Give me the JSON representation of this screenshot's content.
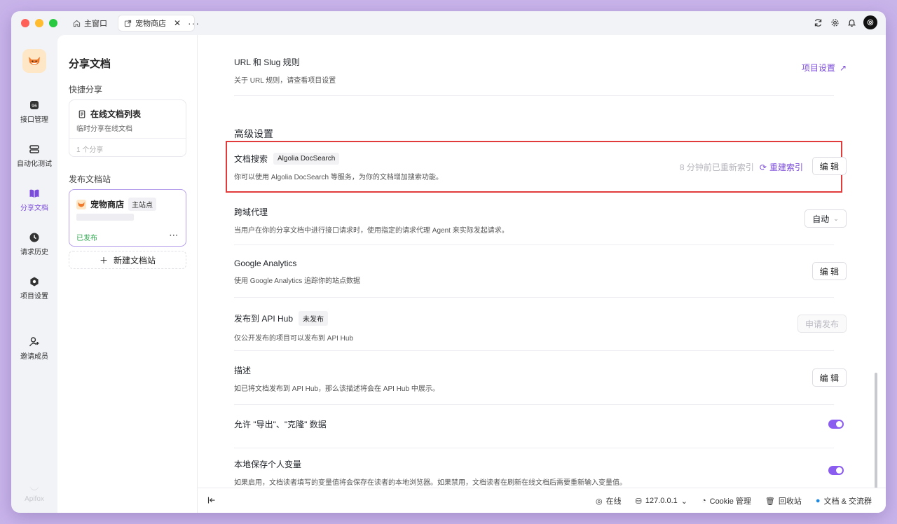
{
  "tabs": [
    {
      "label": "主窗口"
    },
    {
      "label": "宠物商店"
    }
  ],
  "tabs_more": "···",
  "rail": {
    "items": [
      {
        "label": "接口管理",
        "icon": "api-icon"
      },
      {
        "label": "自动化测试",
        "icon": "automation-icon"
      },
      {
        "label": "分享文档",
        "icon": "book-icon"
      },
      {
        "label": "请求历史",
        "icon": "clock-icon"
      },
      {
        "label": "项目设置",
        "icon": "settings-icon"
      },
      {
        "label": "邀请成员",
        "icon": "add-user-icon"
      }
    ],
    "footer": "Apifox"
  },
  "sidebar": {
    "title": "分享文档",
    "quick_share_label": "快捷分享",
    "quick_card": {
      "title": "在线文档列表",
      "desc": "临时分享在线文档",
      "count": "1 个分享"
    },
    "publish_label": "发布文档站",
    "site_card": {
      "title": "宠物商店",
      "tag": "主站点",
      "status": "已发布",
      "more": "···"
    },
    "new_site": "新建文档站"
  },
  "main": {
    "url_slug": {
      "title": "URL 和 Slug 规则",
      "desc": "关于 URL 规则，请查看项目设置",
      "link": "项目设置"
    },
    "advanced_title": "高级设置",
    "doc_search": {
      "title": "文档搜索",
      "tag": "Algolia DocSearch",
      "desc": "你可以使用 Algolia DocSearch 等服务，为你的文档增加搜索功能。",
      "ago": "8 分钟前已重新索引",
      "reindex": "重建索引",
      "edit": "编 辑"
    },
    "cors": {
      "title": "跨域代理",
      "desc": "当用户在你的分享文档中进行接口请求时，使用指定的请求代理 Agent 来实际发起请求。",
      "value": "自动"
    },
    "ga": {
      "title": "Google Analytics",
      "desc": "使用 Google Analytics 追踪你的站点数据",
      "edit": "编 辑"
    },
    "api_hub": {
      "title": "发布到 API Hub",
      "tag": "未发布",
      "desc": "仅公开发布的项目可以发布到 API Hub",
      "button": "申请发布"
    },
    "description": {
      "title": "描述",
      "desc": "如已将文档发布到 API Hub，那么该描述将会在 API Hub 中展示。",
      "edit": "编 辑"
    },
    "export": {
      "title": "允许 \"导出\"、\"克隆\" 数据",
      "enabled": true
    },
    "local_vars": {
      "title": "本地保存个人变量",
      "desc": "如果启用，文档读者填写的变量值将会保存在读者的本地浏览器。如果禁用，文档读者在刷新在线文档后需要重新输入变量值。",
      "enabled": true
    }
  },
  "status": {
    "online": "在线",
    "host": "127.0.0.1",
    "cookie": "Cookie 管理",
    "trash": "回收站",
    "docs": "文档 & 交流群"
  },
  "colors": {
    "accent": "#7c4ddb",
    "highlight": "#e23b3b",
    "published": "#2ea84f"
  }
}
